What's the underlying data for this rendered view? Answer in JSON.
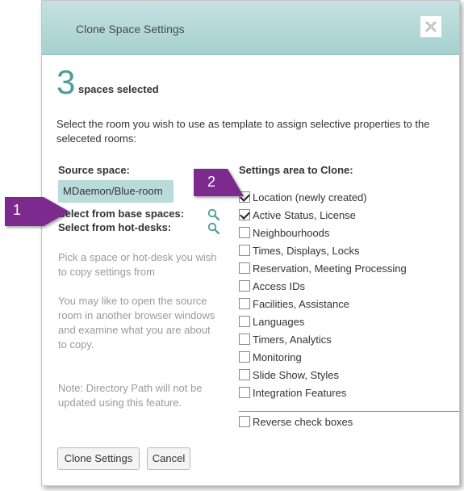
{
  "dialog": {
    "title": "Clone Space Settings",
    "close_icon": "close-icon"
  },
  "selection": {
    "count": "3",
    "label": "spaces selected"
  },
  "intro_text": "Select the room you wish to use as template to assign selective properties to the seleceted rooms:",
  "source": {
    "label": "Source space:",
    "value": "MDaemon/Blue-room",
    "select_base": "Select from base spaces:",
    "select_hotdesk": "Select from hot-desks:",
    "search_icon": "search-icon"
  },
  "help": {
    "p1": "Pick a space or hot-desk you wish to copy settings from",
    "p2": "You may like to open the source room in another browser windows and examine what you are about to copy.",
    "p3": "Note: Directory Path will not be updated using this feature."
  },
  "settings": {
    "label": "Settings area to Clone:",
    "items": [
      {
        "label": "Location (newly created)",
        "checked": true
      },
      {
        "label": "Active Status, License",
        "checked": true
      },
      {
        "label": "Neighbourhoods",
        "checked": false
      },
      {
        "label": "Times, Displays, Locks",
        "checked": false
      },
      {
        "label": "Reservation, Meeting Processing",
        "checked": false
      },
      {
        "label": "Access IDs",
        "checked": false
      },
      {
        "label": "Facilities, Assistance",
        "checked": false
      },
      {
        "label": "Languages",
        "checked": false
      },
      {
        "label": "Timers, Analytics",
        "checked": false
      },
      {
        "label": "Monitoring",
        "checked": false
      },
      {
        "label": "Slide Show, Styles",
        "checked": false
      },
      {
        "label": "Integration Features",
        "checked": false
      }
    ],
    "reverse_label": "Reverse check boxes",
    "reverse_checked": false
  },
  "buttons": {
    "clone": "Clone Settings",
    "cancel": "Cancel"
  },
  "callouts": {
    "one": "1",
    "two": "2"
  },
  "colors": {
    "titlebar": "#a6d0cf",
    "accent": "#4e9b9b",
    "source_bg": "#b9dcdb",
    "callout": "#7b2a8d"
  }
}
